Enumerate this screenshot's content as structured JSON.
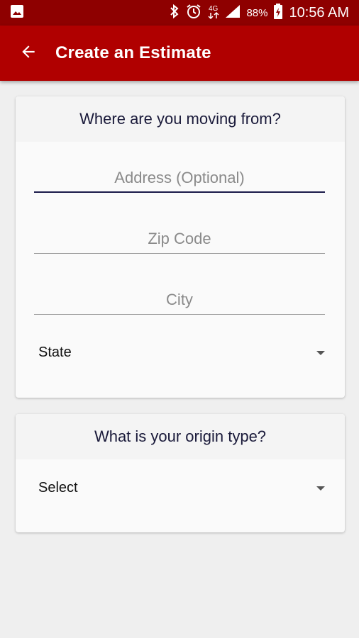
{
  "status_bar": {
    "battery": "88%",
    "time": "10:56 AM",
    "icons": [
      "image-icon",
      "bluetooth-icon",
      "alarm-icon",
      "data-icon",
      "signal-icon",
      "battery-charging-icon"
    ]
  },
  "app_bar": {
    "title": "Create an Estimate",
    "back_icon": "back-arrow-icon",
    "color": "#b00000"
  },
  "moving_from_card": {
    "header": "Where are you moving from?",
    "address_placeholder": "Address (Optional)",
    "zip_placeholder": "Zip Code",
    "city_placeholder": "City",
    "state_value": "State"
  },
  "origin_type_card": {
    "header": "What is your origin type?",
    "select_value": "Select"
  }
}
